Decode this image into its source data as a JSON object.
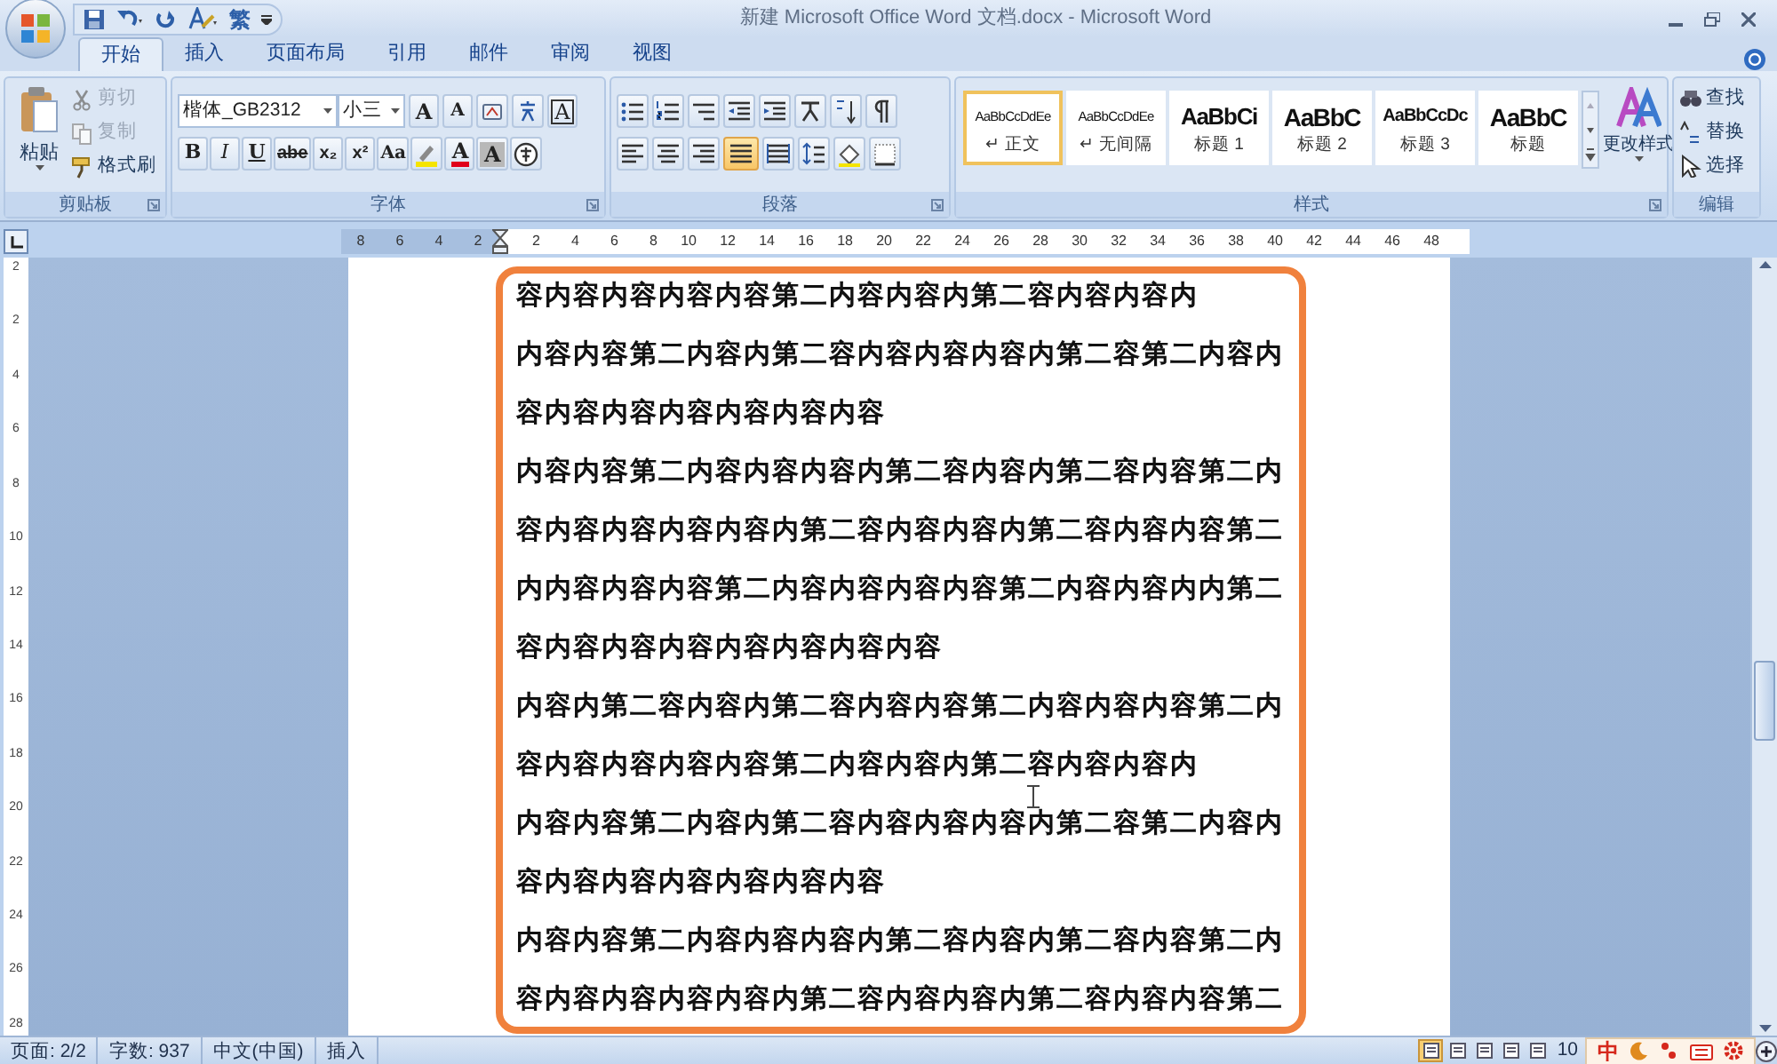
{
  "window": {
    "title": "新建 Microsoft Office Word 文档.docx - Microsoft Word"
  },
  "quick_access": {
    "glyph": "繁"
  },
  "tabs": [
    {
      "label": "开始",
      "selected": true
    },
    {
      "label": "插入",
      "selected": false
    },
    {
      "label": "页面布局",
      "selected": false
    },
    {
      "label": "引用",
      "selected": false
    },
    {
      "label": "邮件",
      "selected": false
    },
    {
      "label": "审阅",
      "selected": false
    },
    {
      "label": "视图",
      "selected": false
    }
  ],
  "clipboard": {
    "paste": "粘贴",
    "label": "剪贴板",
    "items": [
      {
        "kind": "cut",
        "label": "剪切",
        "disabled": true
      },
      {
        "kind": "copy",
        "label": "复制",
        "disabled": true
      },
      {
        "kind": "painter",
        "label": "格式刷",
        "disabled": false
      }
    ]
  },
  "font": {
    "name": "楷体_GB2312",
    "size": "小三",
    "label": "字体",
    "row1": [
      {
        "kind": "grow",
        "text": "A"
      },
      {
        "kind": "shrink",
        "text": "A"
      },
      {
        "kind": "clear"
      },
      {
        "kind": "phonetic"
      },
      {
        "kind": "border",
        "text": "A"
      }
    ],
    "row2": [
      {
        "kind": "bold",
        "text": "B"
      },
      {
        "kind": "italic",
        "text": "I"
      },
      {
        "kind": "underline",
        "text": "U"
      },
      {
        "kind": "strike",
        "text": "abe"
      },
      {
        "kind": "sub",
        "text": "x₂"
      },
      {
        "kind": "sup",
        "text": "x²"
      },
      {
        "kind": "case",
        "text": "Aa"
      },
      {
        "kind": "highlight"
      },
      {
        "kind": "color",
        "text": "A"
      },
      {
        "kind": "shade",
        "text": "A"
      },
      {
        "kind": "enclose"
      }
    ]
  },
  "paragraph": {
    "label": "段落",
    "row1": [
      {
        "kind": "bullets"
      },
      {
        "kind": "numbering"
      },
      {
        "kind": "multilevel"
      },
      {
        "kind": "outdent"
      },
      {
        "kind": "indent"
      },
      {
        "kind": "asian"
      },
      {
        "kind": "sort"
      },
      {
        "kind": "marks"
      }
    ],
    "row2": [
      {
        "kind": "left",
        "selected": false
      },
      {
        "kind": "center",
        "selected": false
      },
      {
        "kind": "right",
        "selected": false
      },
      {
        "kind": "justify",
        "selected": true
      },
      {
        "kind": "distributed",
        "selected": false
      },
      {
        "kind": "spacing"
      },
      {
        "kind": "shading"
      },
      {
        "kind": "borders"
      }
    ]
  },
  "styles": {
    "label": "样式",
    "change": "更改样式",
    "items": [
      {
        "kind": "normal",
        "sample": "AaBbCcDdEe",
        "name": "↵ 正文",
        "selected": true
      },
      {
        "kind": "nospacing",
        "sample": "AaBbCcDdEe",
        "name": "↵ 无间隔",
        "selected": false
      },
      {
        "kind": "h1",
        "sample": "AaBbCi",
        "name": "标题 1",
        "selected": false
      },
      {
        "kind": "h2",
        "sample": "AaBbC",
        "name": "标题 2",
        "selected": false
      },
      {
        "kind": "h3",
        "sample": "AaBbCcDc",
        "name": "标题 3",
        "selected": false
      },
      {
        "kind": "title",
        "sample": "AaBbC",
        "name": "标题",
        "selected": false
      }
    ]
  },
  "editing": {
    "label": "编辑",
    "items": [
      {
        "kind": "find",
        "label": "查找"
      },
      {
        "kind": "replace",
        "label": "替换"
      },
      {
        "kind": "select",
        "label": "选择"
      }
    ]
  },
  "ruler": {
    "left_marks": [
      "8",
      "6",
      "4",
      "2"
    ],
    "right_marks": [
      "2",
      "4",
      "6",
      "8",
      "10",
      "12",
      "14",
      "16",
      "18",
      "20",
      "22",
      "24",
      "26",
      "28",
      "30",
      "32",
      "34",
      "36",
      "38",
      "40",
      "42",
      "44",
      "46",
      "48"
    ]
  },
  "vertical_ruler": [
    "2",
    "2",
    "4",
    "6",
    "8",
    "10",
    "12",
    "14",
    "16",
    "18",
    "20",
    "22",
    "24",
    "26",
    "28"
  ],
  "document": {
    "lines": [
      "容内容内容内容内容第二内容内容内第二容内容内容内",
      "内容内容第二内容内第二容内容内容内容内第二容第二内容内",
      "容内容内容内容内容内容内容",
      "内容内容第二内容内容内容内第二容内容内第二容内容第二内",
      "容内容内容内容内容内第二容内容内容内第二容内容内容第二",
      "内内容内容内容第二内容内容内容内容第二内容内容内内第二",
      "容内容内容内容内容内容内容内容",
      "内容内第二容内容内第二容内容内容第二内容内容内容第二内",
      "容内容内容内容内容第二内容内容内第二容内容内容内",
      "内容内容第二内容内第二容内容内容内容内第二容第二内容内",
      "容内容内容内容内容内容内容",
      "内容内容第二内容内容内容内第二容内容内第二容内容第二内",
      "容内容内容内容内容内第二容内容内容内第二容内容内容第二"
    ]
  },
  "status_bar": {
    "page": "页面: 2/2",
    "words": "字数: 937",
    "language": "中文(中国)",
    "mode": "插入",
    "zoom": "10",
    "ime": "中",
    "views": [
      {
        "selected": true
      },
      {
        "selected": false
      },
      {
        "selected": false
      },
      {
        "selected": false
      },
      {
        "selected": false
      }
    ]
  }
}
